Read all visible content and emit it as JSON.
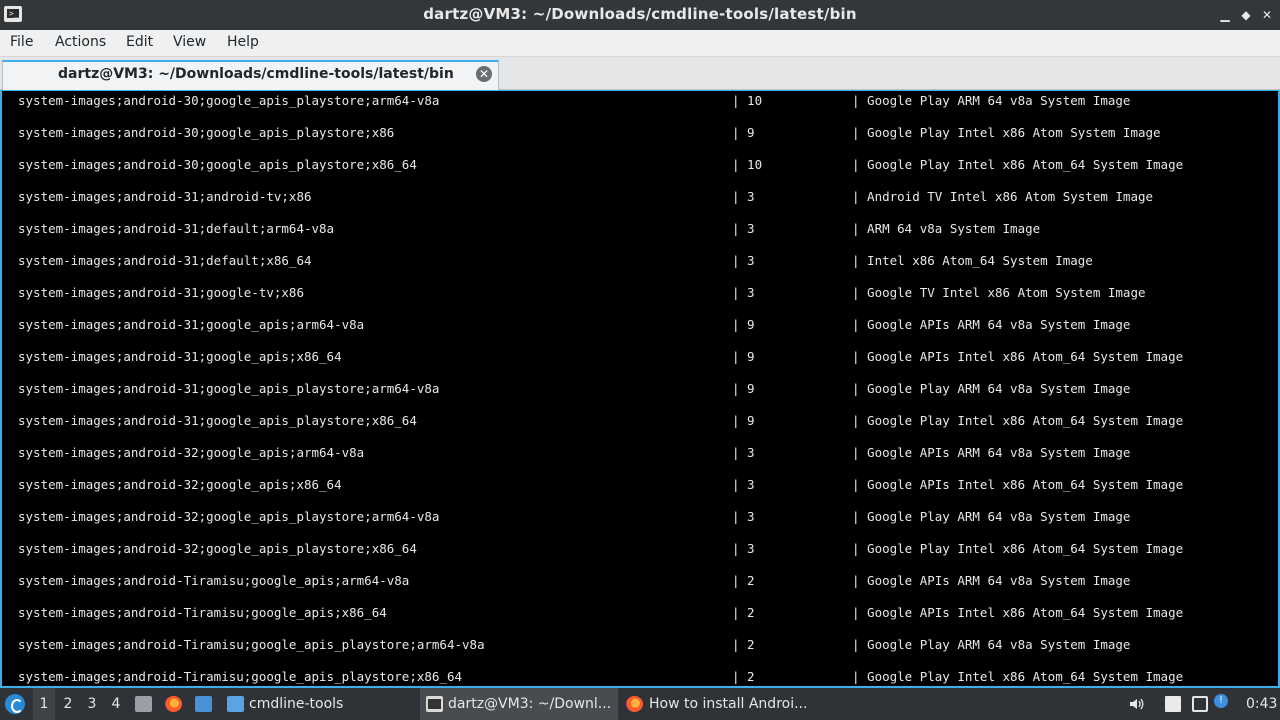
{
  "window": {
    "title": "dartz@VM3: ~/Downloads/cmdline-tools/latest/bin",
    "prompt_glyph": ">_",
    "controls": {
      "minimize": "▁",
      "maximize": "◆",
      "close": "✕"
    }
  },
  "menu": {
    "file": "File",
    "actions": "Actions",
    "edit": "Edit",
    "view": "View",
    "help": "Help"
  },
  "tab": {
    "label": "dartz@VM3: ~/Downloads/cmdline-tools/latest/bin",
    "close_glyph": "✕"
  },
  "terminal": {
    "rows": [
      {
        "path": "system-images;android-30;google_apis_playstore;arm64-v8a",
        "version": "| 10",
        "desc": "| Google Play ARM 64 v8a System Image"
      },
      {
        "path": "system-images;android-30;google_apis_playstore;x86",
        "version": "| 9",
        "desc": "| Google Play Intel x86 Atom System Image"
      },
      {
        "path": "system-images;android-30;google_apis_playstore;x86_64",
        "version": "| 10",
        "desc": "| Google Play Intel x86 Atom_64 System Image"
      },
      {
        "path": "system-images;android-31;android-tv;x86",
        "version": "| 3",
        "desc": "| Android TV Intel x86 Atom System Image"
      },
      {
        "path": "system-images;android-31;default;arm64-v8a",
        "version": "| 3",
        "desc": "| ARM 64 v8a System Image"
      },
      {
        "path": "system-images;android-31;default;x86_64",
        "version": "| 3",
        "desc": "| Intel x86 Atom_64 System Image"
      },
      {
        "path": "system-images;android-31;google-tv;x86",
        "version": "| 3",
        "desc": "| Google TV Intel x86 Atom System Image"
      },
      {
        "path": "system-images;android-31;google_apis;arm64-v8a",
        "version": "| 9",
        "desc": "| Google APIs ARM 64 v8a System Image"
      },
      {
        "path": "system-images;android-31;google_apis;x86_64",
        "version": "| 9",
        "desc": "| Google APIs Intel x86 Atom_64 System Image"
      },
      {
        "path": "system-images;android-31;google_apis_playstore;arm64-v8a",
        "version": "| 9",
        "desc": "| Google Play ARM 64 v8a System Image"
      },
      {
        "path": "system-images;android-31;google_apis_playstore;x86_64",
        "version": "| 9",
        "desc": "| Google Play Intel x86 Atom_64 System Image"
      },
      {
        "path": "system-images;android-32;google_apis;arm64-v8a",
        "version": "| 3",
        "desc": "| Google APIs ARM 64 v8a System Image"
      },
      {
        "path": "system-images;android-32;google_apis;x86_64",
        "version": "| 3",
        "desc": "| Google APIs Intel x86 Atom_64 System Image"
      },
      {
        "path": "system-images;android-32;google_apis_playstore;arm64-v8a",
        "version": "| 3",
        "desc": "| Google Play ARM 64 v8a System Image"
      },
      {
        "path": "system-images;android-32;google_apis_playstore;x86_64",
        "version": "| 3",
        "desc": "| Google Play Intel x86 Atom_64 System Image"
      },
      {
        "path": "system-images;android-Tiramisu;google_apis;arm64-v8a",
        "version": "| 2",
        "desc": "| Google APIs ARM 64 v8a System Image"
      },
      {
        "path": "system-images;android-Tiramisu;google_apis;x86_64",
        "version": "| 2",
        "desc": "| Google APIs Intel x86 Atom_64 System Image"
      },
      {
        "path": "system-images;android-Tiramisu;google_apis_playstore;arm64-v8a",
        "version": "| 2",
        "desc": "| Google Play ARM 64 v8a System Image"
      },
      {
        "path": "system-images;android-Tiramisu;google_apis_playstore;x86_64",
        "version": "| 2",
        "desc": "| Google Play Intel x86 Atom_64 System Image"
      }
    ]
  },
  "taskbar": {
    "workspaces": [
      "1",
      "2",
      "3",
      "4"
    ],
    "active_workspace": "1",
    "tasks": [
      {
        "label": "cmdline-tools",
        "icon": "folder-icon"
      },
      {
        "label": "dartz@VM3: ~/Downl...",
        "icon": "terminal-icon"
      },
      {
        "label": "How to install Androi...",
        "icon": "firefox-icon"
      }
    ],
    "clock": "0:43"
  },
  "colors": {
    "accent": "#3daee9",
    "titlebar": "#33373a",
    "terminal_bg": "#000000",
    "terminal_fg": "#e8e8e8",
    "taskbar": "#2f3337"
  }
}
